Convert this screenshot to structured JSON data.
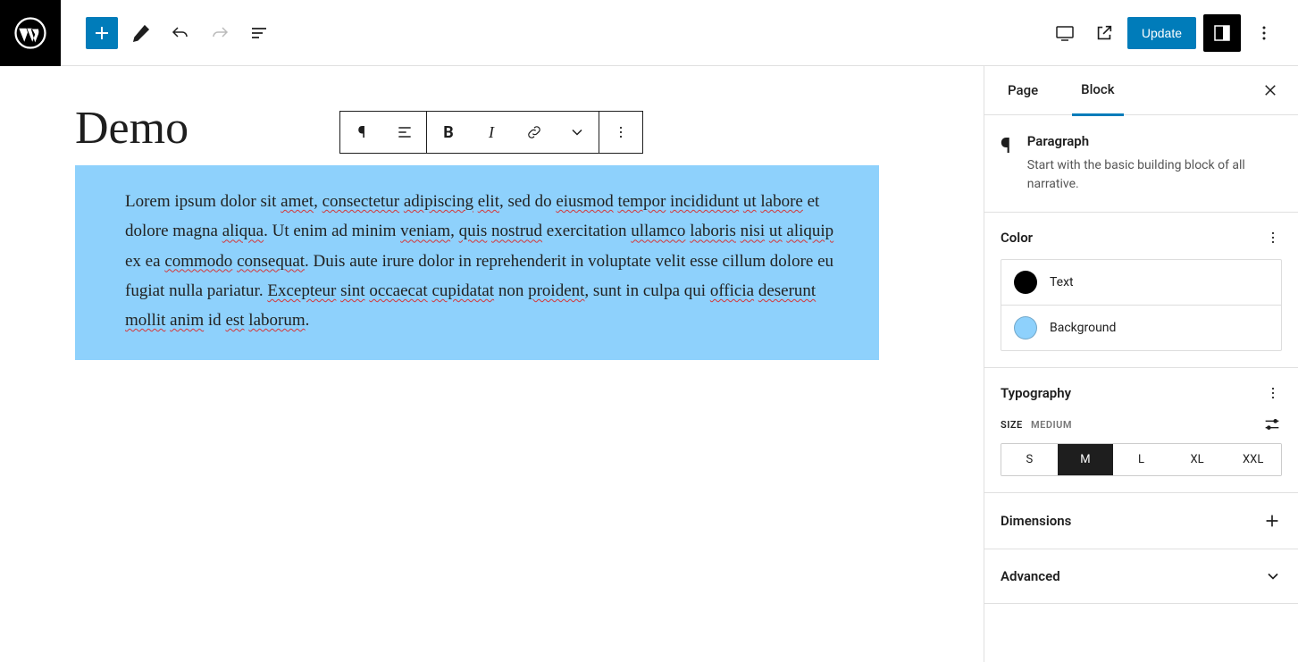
{
  "toolbar": {
    "update_label": "Update"
  },
  "page": {
    "title": "Demo",
    "paragraph": "Lorem ipsum dolor sit amet, consectetur adipiscing elit, sed do eiusmod tempor incididunt ut labore et dolore magna aliqua. Ut enim ad minim veniam, quis nostrud exercitation ullamco laboris nisi ut aliquip ex ea commodo consequat. Duis aute irure dolor in reprehenderit in voluptate velit esse cillum dolore eu fugiat nulla pariatur. Excepteur sint occaecat cupidatat non proident, sunt in culpa qui officia deserunt mollit anim id est laborum."
  },
  "sidebar": {
    "tabs": {
      "page": "Page",
      "block": "Block"
    },
    "block_info": {
      "name": "Paragraph",
      "desc": "Start with the basic building block of all narrative."
    },
    "panels": {
      "color": {
        "title": "Color",
        "text_label": "Text",
        "text_color": "#000000",
        "bg_label": "Background",
        "bg_color": "#8ed1fc"
      },
      "typography": {
        "title": "Typography",
        "size_label": "SIZE",
        "size_value": "MEDIUM",
        "sizes": [
          "S",
          "M",
          "L",
          "XL",
          "XXL"
        ],
        "active_size": "M"
      },
      "dimensions": {
        "title": "Dimensions"
      },
      "advanced": {
        "title": "Advanced"
      }
    }
  }
}
